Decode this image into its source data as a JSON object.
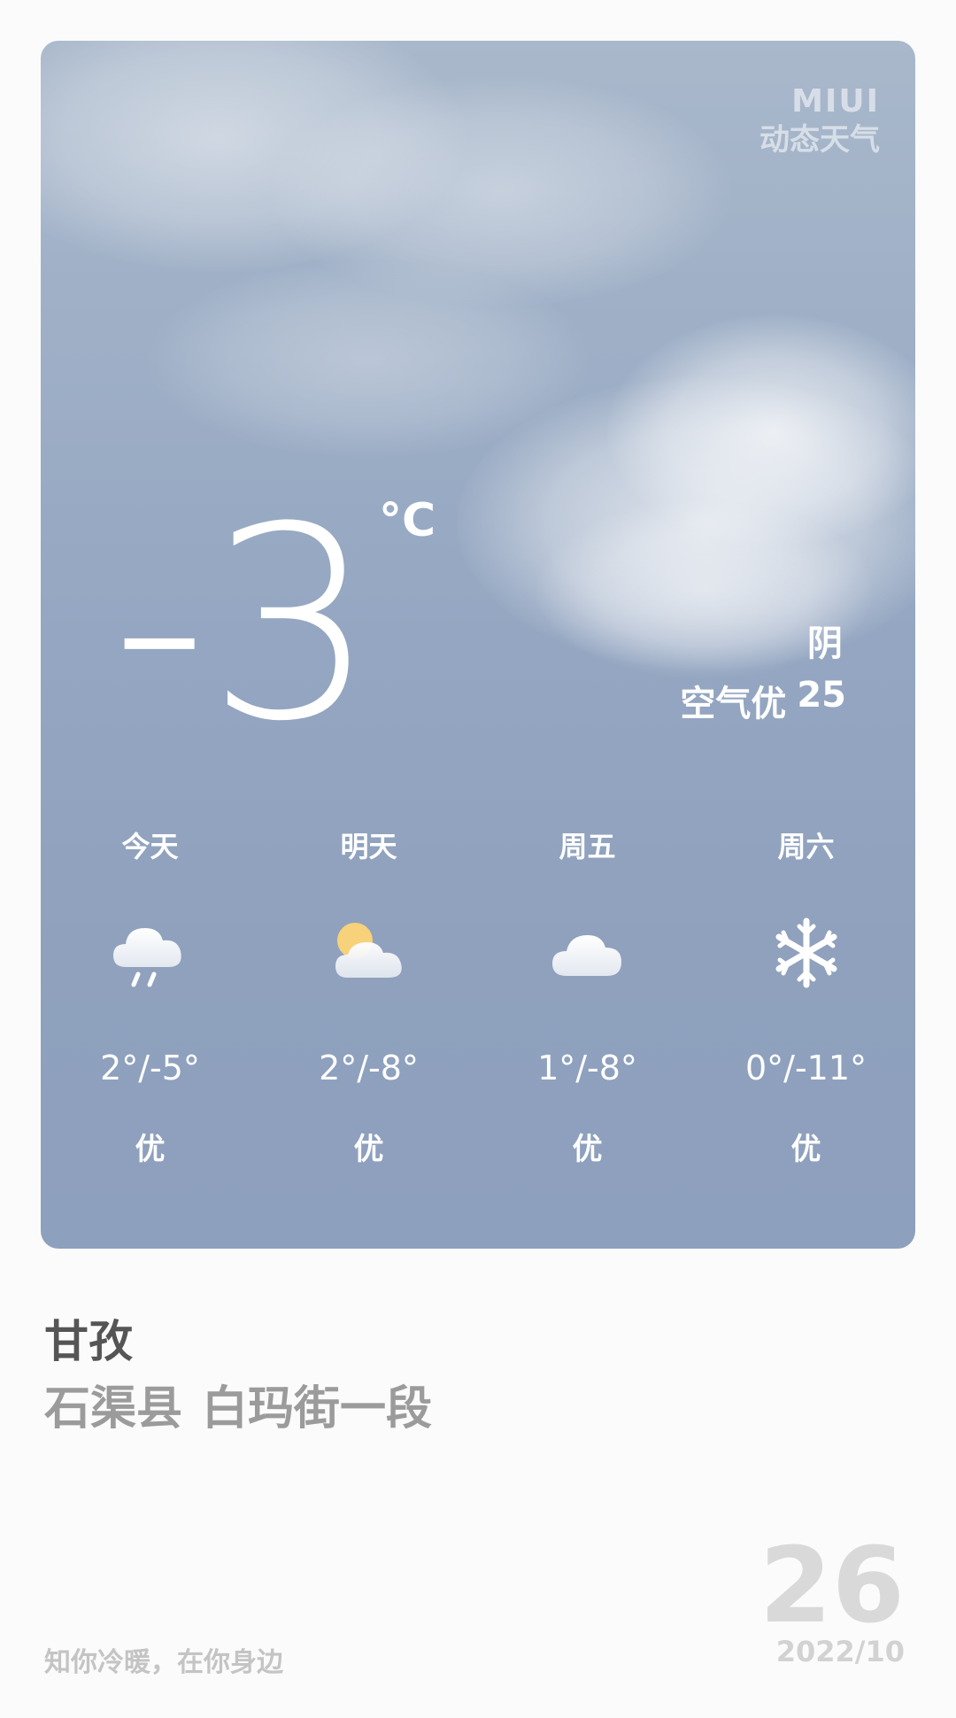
{
  "brand": {
    "line1": "MIUI",
    "line2": "动态天气"
  },
  "current": {
    "temperature": "-3",
    "unit": "°C",
    "condition": "阴",
    "air_label": "空气优",
    "air_value": "25"
  },
  "forecast": [
    {
      "day": "今天",
      "icon": "rain-cloud-icon",
      "range": "2°/-5°",
      "aqi": "优"
    },
    {
      "day": "明天",
      "icon": "partly-sunny-icon",
      "range": "2°/-8°",
      "aqi": "优"
    },
    {
      "day": "周五",
      "icon": "cloud-icon",
      "range": "1°/-8°",
      "aqi": "优"
    },
    {
      "day": "周六",
      "icon": "snowflake-icon",
      "range": "0°/-11°",
      "aqi": "优"
    }
  ],
  "location": {
    "city": "甘孜",
    "county": "石渠县",
    "street": "白玛街一段"
  },
  "footer": {
    "slogan": "知你冷暖，在你身边",
    "day": "26",
    "year_month": "2022/10"
  },
  "colors": {
    "card_top": "#a9b8cb",
    "card_bottom": "#8da0bd",
    "sun": "#f7d27a"
  }
}
